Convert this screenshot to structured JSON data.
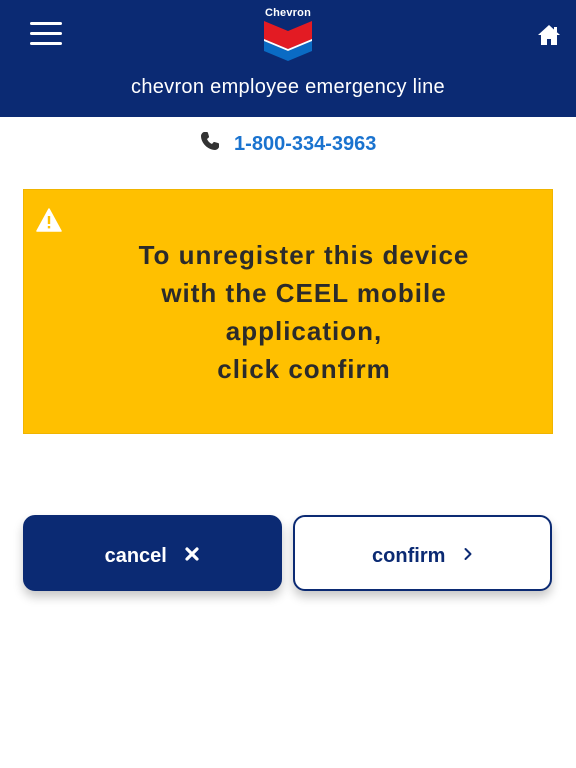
{
  "header": {
    "logo_text": "Chevron",
    "subtitle": "chevron employee emergency line",
    "colors": {
      "background": "#0b2a73",
      "logo_red": "#e31b23",
      "logo_blue": "#0a6bc4"
    }
  },
  "phone": {
    "number": "1-800-334-3963",
    "color": "#1a73cf"
  },
  "alert": {
    "lines": [
      "To unregister this device",
      "with the CEEL mobile",
      "application,",
      "click confirm"
    ],
    "color": "#ffc000"
  },
  "buttons": {
    "cancel_label": "cancel",
    "confirm_label": "confirm"
  },
  "icons": {
    "menu": "hamburger-menu-icon",
    "home": "home-icon",
    "phone": "phone-icon",
    "warning": "warning-triangle-icon",
    "cancel": "x-icon",
    "confirm": "chevron-right-icon"
  }
}
